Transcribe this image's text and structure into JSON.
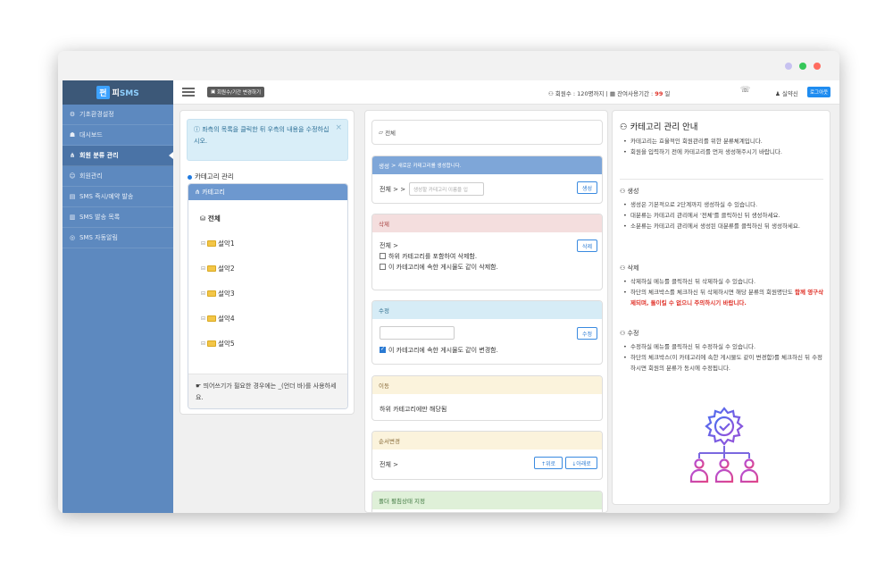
{
  "brand": {
    "badge": "펀",
    "name_pre": "피",
    "name_main": "SMS"
  },
  "topbar": {
    "extend_label": "회원수/기간 변경하기",
    "member_info": "회원수 : 120명까지",
    "period_label": "잔여사용기간 :",
    "days_value": "99",
    "days_unit": "일",
    "user_name": "실약신",
    "logout_label": "로그아웃"
  },
  "sidebar": {
    "items": [
      {
        "icon": "⚙",
        "label": "기초환경설정"
      },
      {
        "icon": "☗",
        "label": "대시보드"
      },
      {
        "icon": "⋔",
        "label": "회원 분류 관리"
      },
      {
        "icon": "☺",
        "label": "회원관리"
      },
      {
        "icon": "▤",
        "label": "SMS 즉시/예약 발송"
      },
      {
        "icon": "▥",
        "label": "SMS 발송 목록"
      },
      {
        "icon": "◎",
        "label": "SMS 자동알림"
      }
    ]
  },
  "left": {
    "alert_text": "좌측의 목록을 클릭한 뒤 우측의 내용을 수정하십시오.",
    "section_label": "카테고리 관리",
    "tree_header": "카테고리",
    "root_label": "전체",
    "nodes": [
      "설악1",
      "설악2",
      "설악3",
      "설악4",
      "설악5"
    ],
    "footer_text": "띄어쓰기가 필요한 경우에는 _(언더 바)를 사용하세요."
  },
  "middle": {
    "breadcrumb": "전체",
    "create": {
      "title": "생성",
      "subtitle": "새로운 카테고리를 생성합니다.",
      "path": "전체 > >",
      "placeholder": "생성할 카테고리 이름을 입",
      "button": "생성"
    },
    "delete": {
      "title": "삭제",
      "path": "전체 >",
      "option1": "하위 카테고리를 포함하여 삭제함.",
      "option2": "이 카테고리에 속한 게시물도 같이 삭제함.",
      "button": "삭제"
    },
    "edit": {
      "title": "수정",
      "option": "이 카테고리에 속한 게시물도 같이 변경함.",
      "button": "수정"
    },
    "move": {
      "title": "이동",
      "text": "하위 카테고리에만 해당됨"
    },
    "order": {
      "title": "순서변경",
      "path": "전체 >",
      "up": "↑위로",
      "down": "↓아래로"
    },
    "folder": {
      "title": "폴더 펼침상태 지정"
    }
  },
  "right": {
    "title": "카테고리 관리 안내",
    "intro": [
      "카테고리는 효율적인 회원관리를 위한 분류체계입니다.",
      "회원을 입력하기 전에 카테고리를 먼저 생성해주시기 바랍니다."
    ],
    "create_head": "생성",
    "create_items": [
      "생성은 기본적으로 2단계까지 생성하실 수 있습니다.",
      "대분류는 카테고리 관리에서 '전체'를 클릭하신 뒤 생성하세요.",
      "소분류는 카테고리 관리에서 생성된 대분류를 클릭하신 뒤 생성하세요."
    ],
    "delete_head": "삭제",
    "delete_items": [
      "삭제하실 메뉴를 클릭하신 뒤 삭제하실 수 있습니다.",
      "하단의 체크박스를 체크하신 뒤 삭제하시면 해당 분류의 회원명단도"
    ],
    "delete_warn": "함께 영구삭제되며, 돌이킬 수 없으니 주의하시기 바랍니다.",
    "edit_head": "수정",
    "edit_items": [
      "수정하실 메뉴를 클릭하신 뒤 수정하실 수 있습니다.",
      "하단의 체크박스(이 카테고리에 속한 게시물도 같이 변경함)를 체크하신 뒤 수정하시면 회원의 분류가 동시에 수정됩니다."
    ]
  },
  "colors": {
    "sidebar": "#5d89bf",
    "accent": "#1f8cf0",
    "warn": "#e0342b"
  }
}
